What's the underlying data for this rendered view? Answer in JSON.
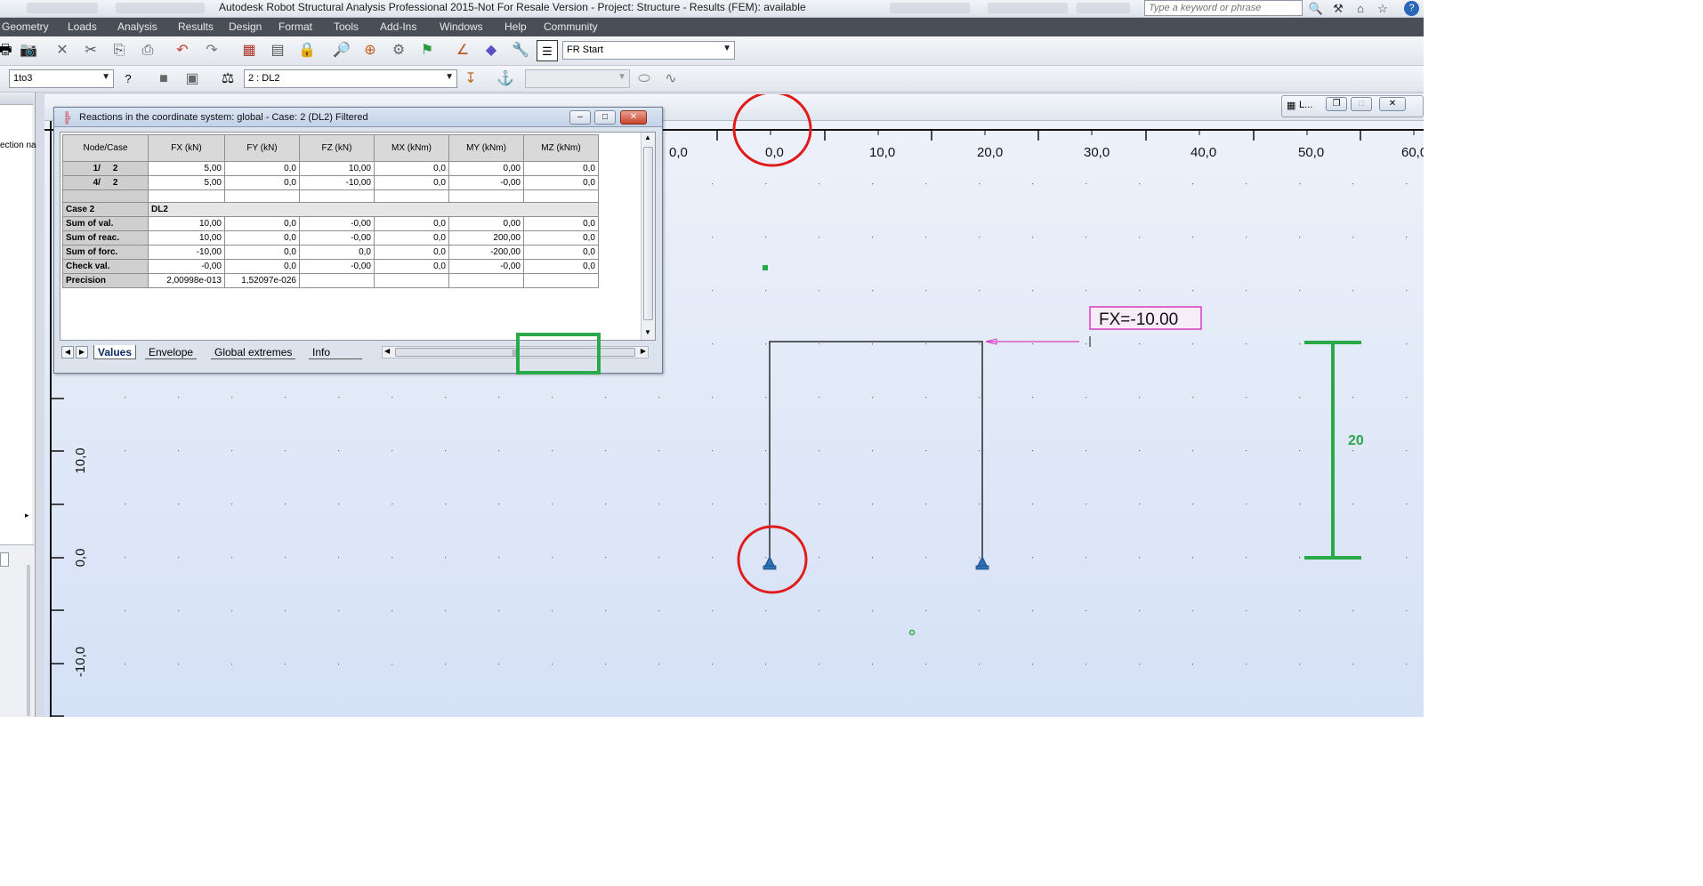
{
  "app_title": "Autodesk Robot Structural Analysis Professional 2015-Not For Resale Version - Project: Structure - Results (FEM): available",
  "search_placeholder": "Type a keyword or phrase",
  "menu": [
    "Geometry",
    "Loads",
    "Analysis",
    "Results",
    "Design",
    "Format",
    "Tools",
    "Add-Ins",
    "Windows",
    "Help",
    "Community"
  ],
  "toolbar1": {
    "layout_combo": "Start",
    "layout_prefix": "FR"
  },
  "toolbar2": {
    "selection_combo": "1to3",
    "case_combo": "2 : DL2",
    "case_prefix_icon": "load-case-icon",
    "extra_combo": ""
  },
  "leftpanel": {
    "text": "ection na"
  },
  "minimized_view": {
    "label": "L..."
  },
  "dialog": {
    "title": "Reactions in the coordinate system: global - Case: 2 (DL2) Filtered",
    "columns": [
      "Node/Case",
      "FX (kN)",
      "FY (kN)",
      "FZ (kN)",
      "MX (kNm)",
      "MY (kNm)",
      "MZ (kNm)"
    ],
    "rows": [
      {
        "node": "1/",
        "case": "2",
        "fx": "5,00",
        "fy": "0,0",
        "fz": "10,00",
        "mx": "0,0",
        "my": "0,00",
        "mz": "0,0"
      },
      {
        "node": "4/",
        "case": "2",
        "fx": "5,00",
        "fy": "0,0",
        "fz": "-10,00",
        "mx": "0,0",
        "my": "-0,00",
        "mz": "0,0"
      }
    ],
    "case_row": {
      "label": "Case 2",
      "value": "DL2"
    },
    "summary": [
      {
        "label": "Sum of val.",
        "fx": "10,00",
        "fy": "0,0",
        "fz": "-0,00",
        "mx": "0,0",
        "my": "0,00",
        "mz": "0,0"
      },
      {
        "label": "Sum of reac.",
        "fx": "10,00",
        "fy": "0,0",
        "fz": "-0,00",
        "mx": "0,0",
        "my": "200,00",
        "mz": "0,0"
      },
      {
        "label": "Sum of forc.",
        "fx": "-10,00",
        "fy": "0,0",
        "fz": "0,0",
        "mx": "0,0",
        "my": "-200,00",
        "mz": "0,0"
      },
      {
        "label": "Check val.",
        "fx": "-0,00",
        "fy": "0,0",
        "fz": "-0,00",
        "mx": "0,0",
        "my": "-0,00",
        "mz": "0,0"
      },
      {
        "label": "Precision",
        "fx": "2,00998e-013",
        "fy": "1,52097e-026",
        "fz": "",
        "mx": "",
        "my": "",
        "mz": ""
      }
    ],
    "tabs": [
      "Values",
      "Envelope",
      "Global extremes",
      "Info"
    ],
    "active_tab": "Values"
  },
  "view": {
    "x_ticks": [
      "0,0",
      "0,0",
      "10,0",
      "20,0",
      "30,0",
      "40,0",
      "50,0",
      "60,0"
    ],
    "y_ticks": [
      "10,0",
      "0,0",
      "-10,0"
    ],
    "load_label": "FX=-10.00",
    "dimension_label": "20",
    "colors": {
      "frame": "#2a2a2a",
      "load": "#d63cc2",
      "annotation_circle": "#e01b1b",
      "highlight": "#2aa94a",
      "support": "#2f6fb3"
    }
  }
}
